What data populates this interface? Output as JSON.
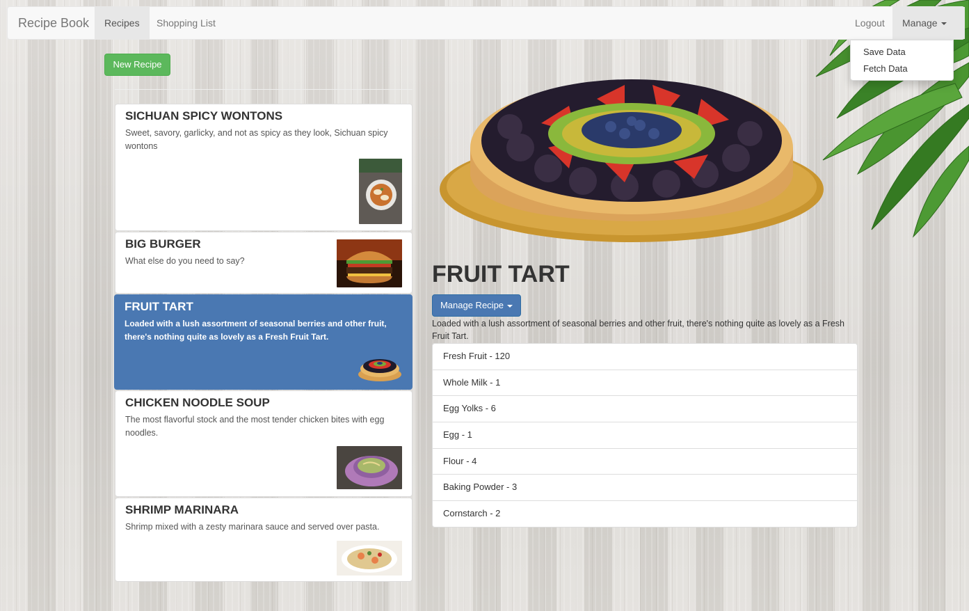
{
  "navbar": {
    "brand": "Recipe Book",
    "links": [
      "Recipes",
      "Shopping List"
    ],
    "logout": "Logout",
    "manage": "Manage",
    "manage_menu": [
      "Save Data",
      "Fetch Data"
    ]
  },
  "actions": {
    "new_recipe": "New Recipe"
  },
  "recipes": [
    {
      "name": "SICHUAN SPICY WONTONS",
      "description": "Sweet, savory, garlicky, and not as spicy as they look, Sichuan spicy wontons",
      "image": "wonton-bowl"
    },
    {
      "name": "BIG BURGER",
      "description": "What else do you need to say?",
      "image": "burger"
    },
    {
      "name": "FRUIT TART",
      "description": "Loaded with a lush assortment of seasonal berries and other fruit, there's nothing quite as lovely as a Fresh Fruit Tart.",
      "image": "fruit-tart"
    },
    {
      "name": "CHICKEN NOODLE SOUP",
      "description": "The most flavorful stock and the most tender chicken bites with egg noodles.",
      "image": "soup-bowl"
    },
    {
      "name": "SHRIMP MARINARA",
      "description": "Shrimp mixed with a zesty marinara sauce and served over pasta.",
      "image": "shrimp-pasta"
    }
  ],
  "selected_recipe_index": 2,
  "detail": {
    "title": "FRUIT TART",
    "manage_button": "Manage Recipe",
    "description": "Loaded with a lush assortment of seasonal berries and other fruit, there's nothing quite as lovely as a Fresh Fruit Tart.",
    "ingredients": [
      "Fresh Fruit - 120",
      "Whole Milk - 1",
      "Egg Yolks - 6",
      "Egg - 1",
      "Flour - 4",
      "Baking Powder - 3",
      "Cornstarch - 2"
    ]
  },
  "colors": {
    "primary": "#4a78b2",
    "success": "#5cb85c",
    "navbar_bg": "#f8f8f8"
  }
}
